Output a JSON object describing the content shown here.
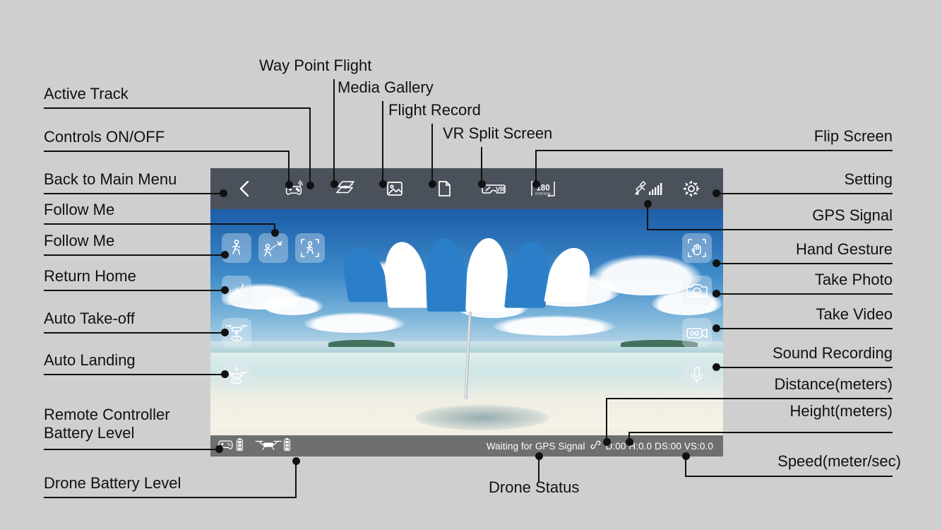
{
  "app": {
    "toolbar": {
      "items": [
        {
          "name": "back-to-main-menu",
          "icon": "chevron-left-icon",
          "label": "Back to Main Menu"
        },
        {
          "name": "controls-on-off",
          "icon": "gamepad-signal-icon",
          "label": "Controls ON/OFF"
        },
        {
          "name": "way-point-flight",
          "icon": "waypoint-path-icon",
          "label": "Way Point Flight"
        },
        {
          "name": "media-gallery",
          "icon": "image-icon",
          "label": "Media Gallery"
        },
        {
          "name": "flight-record",
          "icon": "document-icon",
          "label": "Flight Record"
        },
        {
          "name": "vr-split-screen",
          "icon": "vr-goggles-icon",
          "label": "VR Split Screen"
        },
        {
          "name": "flip-screen",
          "icon": "180-flip-icon",
          "label": "Flip Screen"
        },
        {
          "name": "gps-signal",
          "icon": "satellite-signal-icon",
          "label": "GPS Signal"
        },
        {
          "name": "setting",
          "icon": "gear-icon",
          "label": "Setting"
        }
      ],
      "flip_icon_text": "180",
      "flip_icon_sub": "EVERSION",
      "vr_icon_text": "VR"
    },
    "left_controls": [
      {
        "name": "follow-me-1",
        "icon": "walking-person-icon",
        "label": "Follow Me"
      },
      {
        "name": "follow-me-2",
        "icon": "person-follow-drone-icon",
        "label": "Follow Me"
      },
      {
        "name": "active-track",
        "icon": "person-track-frame-icon",
        "label": "Active Track"
      },
      {
        "name": "return-home",
        "icon": "return-to-home-icon",
        "label": "Return Home"
      },
      {
        "name": "auto-take-off",
        "icon": "drone-up-icon",
        "label": "Auto Take-off"
      },
      {
        "name": "auto-landing",
        "icon": "drone-down-icon",
        "label": "Auto Landing"
      }
    ],
    "right_controls": [
      {
        "name": "hand-gesture",
        "icon": "hand-gesture-icon",
        "label": "Hand Gesture"
      },
      {
        "name": "take-photo",
        "icon": "camera-icon",
        "label": "Take Photo"
      },
      {
        "name": "take-video",
        "icon": "camcorder-icon",
        "label": "Take Video"
      },
      {
        "name": "sound-recording",
        "icon": "microphone-icon",
        "label": "Sound Recording"
      }
    ],
    "status_bar": {
      "remote_battery_icon": "gamepad-icon",
      "remote_battery_level_icon": "battery-icon",
      "drone_battery_icon": "drone-icon",
      "drone_battery_level_icon": "battery-icon",
      "link_icon": "link-icon",
      "drone_status": "Waiting for GPS Signal",
      "telemetry": "D:00 H:0.0 DS:00 VS:0.0",
      "telemetry_fields": {
        "distance": "D:00",
        "height": "H:0.0",
        "distance_speed": "DS:00",
        "vertical_speed": "VS:0.0"
      }
    }
  },
  "annotations": {
    "left": [
      {
        "name": "annotation-active-track",
        "text": "Active Track"
      },
      {
        "name": "annotation-controls-on-off",
        "text": "Controls ON/OFF"
      },
      {
        "name": "annotation-back-to-main-menu",
        "text": "Back to Main Menu"
      },
      {
        "name": "annotation-follow-me-1",
        "text": "Follow Me"
      },
      {
        "name": "annotation-follow-me-2",
        "text": "Follow Me"
      },
      {
        "name": "annotation-return-home",
        "text": "Return Home"
      },
      {
        "name": "annotation-auto-take-off",
        "text": "Auto Take-off"
      },
      {
        "name": "annotation-auto-landing",
        "text": "Auto Landing"
      },
      {
        "name": "annotation-remote-controller-battery-line1",
        "text": "Remote Controller"
      },
      {
        "name": "annotation-remote-controller-battery-line2",
        "text": "Battery Level"
      },
      {
        "name": "annotation-drone-battery-level",
        "text": "Drone Battery Level"
      }
    ],
    "top": [
      {
        "name": "annotation-way-point-flight",
        "text": "Way Point Flight"
      },
      {
        "name": "annotation-media-gallery",
        "text": "Media Gallery"
      },
      {
        "name": "annotation-flight-record",
        "text": "Flight Record"
      },
      {
        "name": "annotation-vr-split-screen",
        "text": "VR Split Screen"
      }
    ],
    "right": [
      {
        "name": "annotation-flip-screen",
        "text": "Flip Screen"
      },
      {
        "name": "annotation-setting",
        "text": "Setting"
      },
      {
        "name": "annotation-gps-signal",
        "text": "GPS Signal"
      },
      {
        "name": "annotation-hand-gesture",
        "text": "Hand Gesture"
      },
      {
        "name": "annotation-take-photo",
        "text": "Take Photo"
      },
      {
        "name": "annotation-take-video",
        "text": "Take Video"
      },
      {
        "name": "annotation-sound-recording",
        "text": "Sound Recording"
      },
      {
        "name": "annotation-distance",
        "text": "Distance(meters)"
      },
      {
        "name": "annotation-height",
        "text": "Height(meters)"
      },
      {
        "name": "annotation-speed",
        "text": "Speed(meter/sec)"
      }
    ],
    "bottom": [
      {
        "name": "annotation-drone-status",
        "text": "Drone Status"
      }
    ]
  },
  "colors": {
    "page_background": "#cfcfcf",
    "toolbar": "#4a515b",
    "status_bar": "#6d6f71",
    "sky": "#1f63ad",
    "umbrella_blue": "#1f7fd0",
    "umbrella_white": "#ffffff",
    "annotation_text": "#111111",
    "leader_line": "#111111"
  }
}
